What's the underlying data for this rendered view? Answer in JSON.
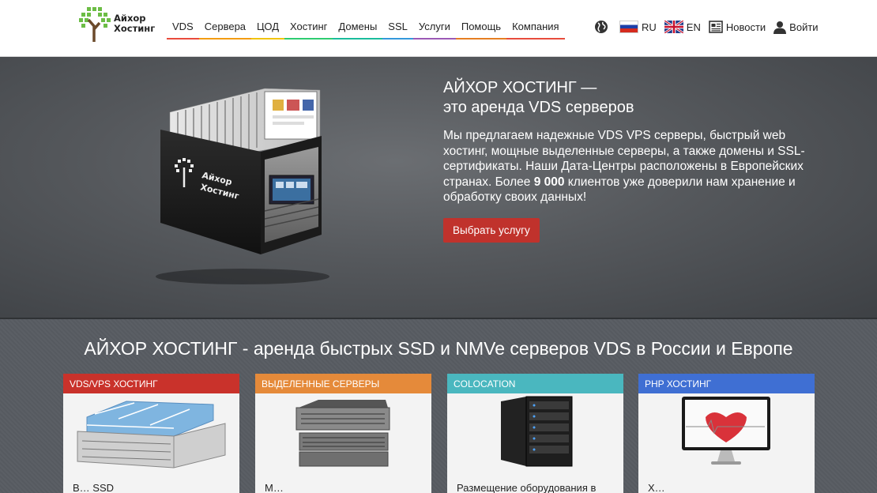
{
  "brand": {
    "line1": "Айхор",
    "line2": "Хостинг"
  },
  "nav": [
    {
      "label": "VDS",
      "color": "#e94b3c"
    },
    {
      "label": "Сервера",
      "color": "#f39c12"
    },
    {
      "label": "ЦОД",
      "color": "#f1c40f"
    },
    {
      "label": "Хостинг",
      "color": "#2ecc71"
    },
    {
      "label": "Домены",
      "color": "#1abc9c"
    },
    {
      "label": "SSL",
      "color": "#3498db"
    },
    {
      "label": "Услуги",
      "color": "#9b59b6"
    },
    {
      "label": "Помощь",
      "color": "#e67e22"
    },
    {
      "label": "Компания",
      "color": "#e74c3c"
    }
  ],
  "lang": {
    "ru": "RU",
    "en": "EN"
  },
  "news_label": "Новости",
  "login_label": "Войти",
  "hero": {
    "title1": "АЙХОР ХОСТИНГ —",
    "title2": "это аренда VDS серверов",
    "desc_before": "Мы предлагаем надежные VDS VPS серверы, быстрый web хостинг, мощные выделенные серверы, а также домены и SSL-сертификаты. Наши Дата-Центры расположены в Европейских странах. Более ",
    "desc_bold": "9 000",
    "desc_after": " клиентов уже доверили нам хранение и обработку своих данных!",
    "button": "Выбрать услугу",
    "illus_brand1": "Айхор",
    "illus_brand2": "Хостинг"
  },
  "section_title": "АЙХОР ХОСТИНГ - аренда быстрых SSD и NMVe серверов VDS в России и Европе",
  "cards": [
    {
      "title": "VDS/VPS хостинг",
      "color": "#c9322b",
      "text": "В… SSD"
    },
    {
      "title": "Выделенные серверы",
      "color": "#e58a3a",
      "text": "М…"
    },
    {
      "title": "Colocation",
      "color": "#4ab7bf",
      "text": "Размещение оборудования в"
    },
    {
      "title": "PHP хостинг",
      "color": "#3f6fd3",
      "text": "Х…"
    }
  ],
  "colors": {
    "accent_red": "#c0322c"
  }
}
